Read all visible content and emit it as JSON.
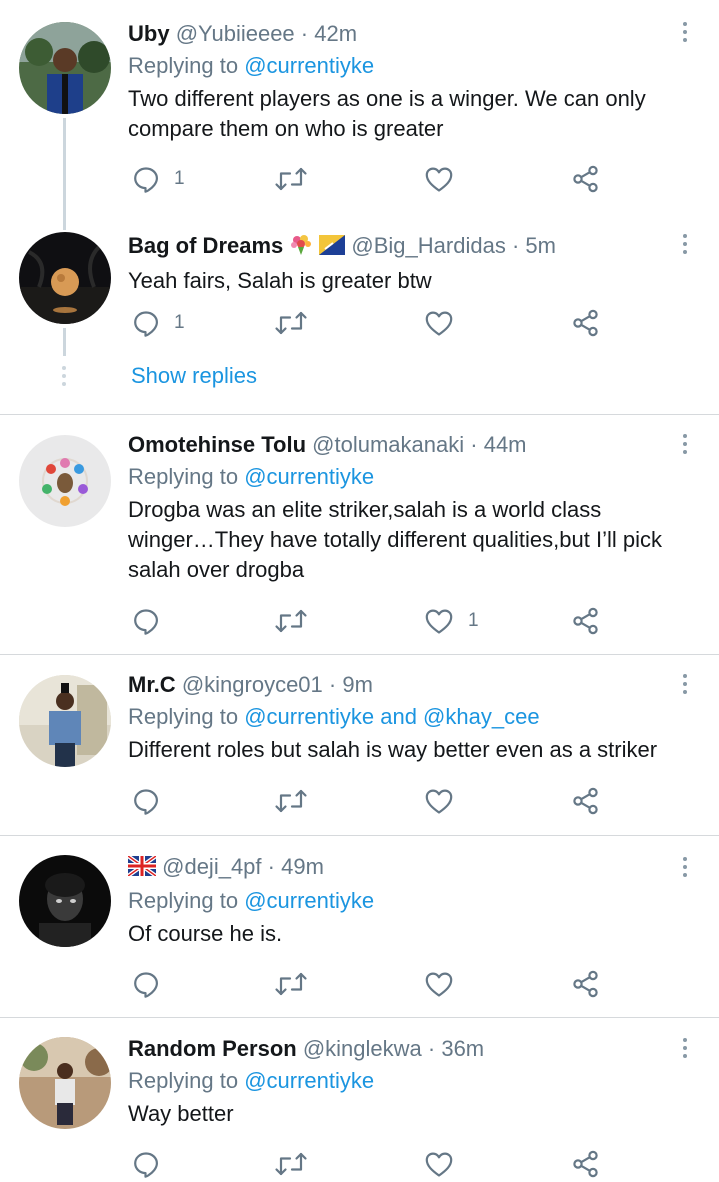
{
  "tweets": [
    {
      "name": "Uby",
      "handle": "@Yubiieeee",
      "time": "· 42m",
      "replying_prefix": "Replying to",
      "replying_to": "@currentiyke",
      "text": "Two different players as one is a winger. We can only compare them on who is greater",
      "reply_count": "1",
      "retweet_count": "",
      "like_count": ""
    },
    {
      "name": "Bag of Dreams",
      "emojis": [
        "bouquet",
        "flag"
      ],
      "handle": "@Big_Hardidas",
      "time": "· 5m",
      "text": "Yeah fairs, Salah is greater btw",
      "reply_count": "1",
      "retweet_count": "",
      "like_count": ""
    },
    {
      "name": "Omotehinse Tolu",
      "handle": "@tolumakanaki",
      "time": "· 44m",
      "replying_prefix": "Replying to",
      "replying_to": "@currentiyke",
      "text": "Drogba was an elite striker,salah is a world class winger…They have totally different qualities,but I’ll pick salah over drogba",
      "reply_count": "",
      "retweet_count": "",
      "like_count": "1"
    },
    {
      "name": "Mr.C",
      "handle": "@kingroyce01",
      "time": "· 9m",
      "replying_prefix": "Replying to",
      "replying_to": "@currentiyke and @khay_cee",
      "text": "Different roles but salah is way better even as a striker",
      "reply_count": "",
      "retweet_count": "",
      "like_count": ""
    },
    {
      "name": "",
      "emojis": [
        "uk-flag"
      ],
      "handle": "@deji_4pf",
      "time": "· 49m",
      "replying_prefix": "Replying to",
      "replying_to": "@currentiyke",
      "text": "Of course he is.",
      "reply_count": "",
      "retweet_count": "",
      "like_count": ""
    },
    {
      "name": "Random Person",
      "handle": "@kinglekwa",
      "time": "· 36m",
      "replying_prefix": "Replying to",
      "replying_to": "@currentiyke",
      "text": "Way better",
      "reply_count": "",
      "retweet_count": "",
      "like_count": ""
    }
  ],
  "show_replies": "Show replies",
  "icons": {
    "reply": "reply-icon",
    "retweet": "retweet-icon",
    "like": "heart-icon",
    "share": "share-icon",
    "more": "more-vertical-icon"
  },
  "colors": {
    "link": "#1b95e0",
    "secondary": "#657786",
    "divider": "#d6d9dc"
  }
}
